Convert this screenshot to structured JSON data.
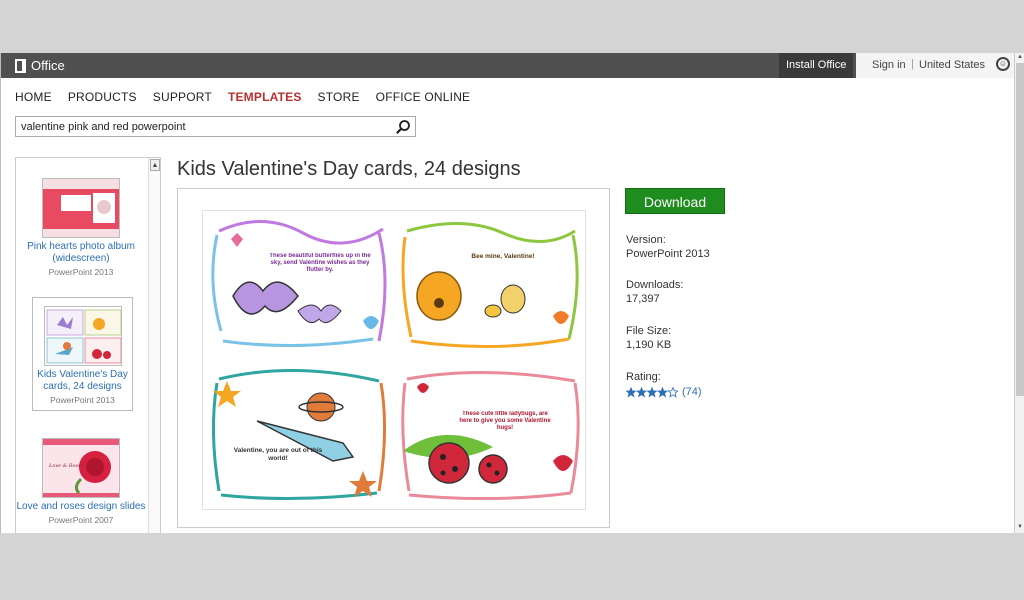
{
  "header": {
    "logo_text": "Office",
    "install_label": "Install Office",
    "signin_label": "Sign in",
    "separator": "|",
    "country_label": "United States"
  },
  "nav": {
    "items": [
      {
        "label": "HOME"
      },
      {
        "label": "PRODUCTS"
      },
      {
        "label": "SUPPORT"
      },
      {
        "label": "TEMPLATES",
        "active": true
      },
      {
        "label": "STORE"
      },
      {
        "label": "OFFICE ONLINE"
      }
    ]
  },
  "search": {
    "value": "valentine pink and red powerpoint"
  },
  "sidebar": {
    "items": [
      {
        "name": "Pink hearts photo album (widescreen)",
        "version": "PowerPoint 2013"
      },
      {
        "name": "Kids Valentine's Day cards, 24 designs",
        "version": "PowerPoint 2013"
      },
      {
        "name": "Love and roses design slides",
        "version": "PowerPoint 2007"
      }
    ]
  },
  "main": {
    "title": "Kids Valentine's Day cards, 24 designs",
    "download_label": "Download",
    "cards": [
      {
        "text": "These beautiful butterflies up in the sky, send Valentine wishes as they flutter by."
      },
      {
        "text": "Bee mine, Valentine!"
      },
      {
        "text": "Valentine, you are out of this world!"
      },
      {
        "text": "These cute little ladybugs, are here to give you some Valentine hugs!"
      }
    ],
    "details": {
      "version_label": "Version:",
      "version_value": "PowerPoint 2013",
      "downloads_label": "Downloads:",
      "downloads_value": "17,397",
      "filesize_label": "File Size:",
      "filesize_value": "1,190 KB",
      "rating_label": "Rating:",
      "rating_count": "(74)",
      "rating_stars": 4
    }
  },
  "colors": {
    "accent_red": "#b8312f",
    "download_green": "#1e8c1e",
    "link_blue": "#2d6fb5",
    "topbar": "#505050"
  }
}
